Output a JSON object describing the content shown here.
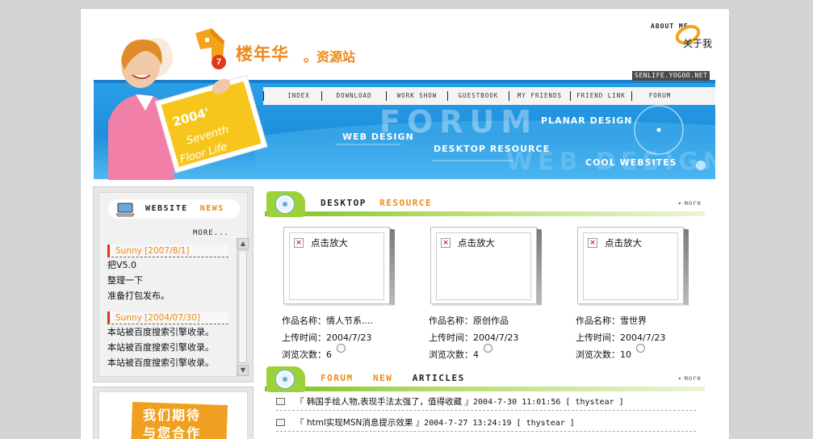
{
  "header": {
    "logo_digit": "7",
    "site_name": "楼年华",
    "site_sub": "。资源站",
    "about_en": "ABOUT ME",
    "about_cn": "关于我",
    "domain": "SENLIFE.YOGOO.NET"
  },
  "nav": [
    "INDEX",
    "DOWNLOAD",
    "WORK SHOW",
    "GUESTBOOK",
    "MY FRIENDS",
    "FRIEND LINK",
    "FORUM"
  ],
  "banner": {
    "big_word": "FORUM",
    "big_word2": "WEB DESIGN",
    "words": [
      "PLANAR DESIGN",
      "WEB DESIGN",
      "DESKTOP RESOURCE",
      "COOL WEBSITES"
    ],
    "sign_year": "2004'",
    "sign_line1": "Seventh",
    "sign_line2": "Floor  Life"
  },
  "news": {
    "title_a": "WEBSITE",
    "title_b": "NEWS",
    "more": "MORE...",
    "groups": [
      {
        "date": "Sunny [2007/8/1]",
        "lines": [
          "把V5.0",
          "整理一下",
          "准备打包发布。"
        ]
      },
      {
        "date": "Sunny [2004/07/30]",
        "lines": [
          "本站被百度搜索引擎收录。",
          "本站被百度搜索引擎收录。",
          "本站被百度搜索引擎收录。"
        ]
      }
    ]
  },
  "promo": {
    "line1": "我们期待",
    "line2": "与您合作"
  },
  "resources": {
    "title_a": "DESKTOP",
    "title_b": "RESOURCE",
    "more": "more",
    "items": [
      {
        "alt": "点击放大",
        "name": "作品名称：情人节系....",
        "time": "上传时间：2004/7/23",
        "views": "浏览次数：6"
      },
      {
        "alt": "点击放大",
        "name": "作品名称：原创作品",
        "time": "上传时间：2004/7/23",
        "views": "浏览次数：4"
      },
      {
        "alt": "点击放大",
        "name": "作品名称：雪世界",
        "time": "上传时间：2004/7/23",
        "views": "浏览次数：10"
      }
    ]
  },
  "forum": {
    "title_a": "FORUM",
    "title_b": "NEW",
    "title_c": "ARTICLES",
    "more": "more",
    "articles": [
      {
        "title": "『 韩国手绘人物,表现手法太强了，值得收藏 』",
        "meta": "2004-7-30 11:01:56 [ thystear ]"
      },
      {
        "title": "『 html实现MSN消息提示效果 』",
        "meta": "2004-7-27 13:24:19 [ thystear ]"
      }
    ]
  },
  "colors": {
    "accent": "#ee8a18",
    "banner": "#1f8fdc",
    "green": "#7fbf22",
    "red": "#e03818"
  }
}
